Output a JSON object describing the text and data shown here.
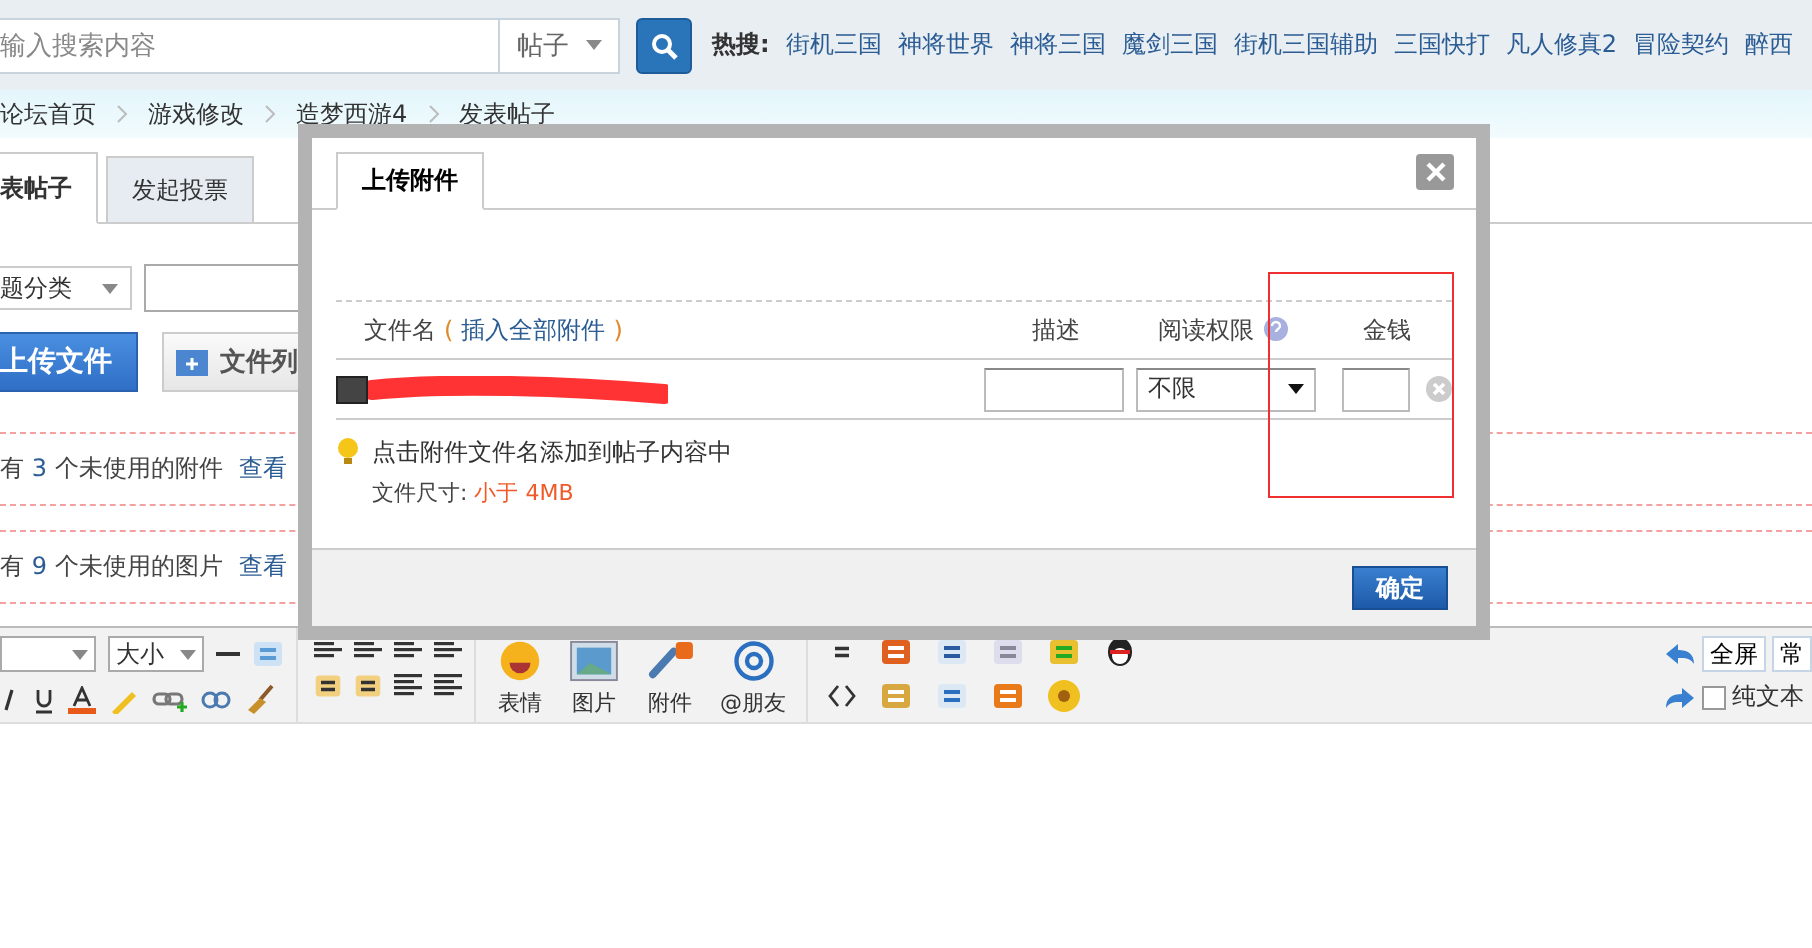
{
  "search": {
    "placeholder": "输入搜索内容",
    "scope": "帖子"
  },
  "hot_search": {
    "label": "热搜:",
    "links": [
      "街机三国",
      "神将世界",
      "神将三国",
      "魔剑三国",
      "街机三国辅助",
      "三国快打",
      "凡人修真2",
      "冒险契约",
      "醉西"
    ]
  },
  "breadcrumb": [
    "论坛首页",
    "游戏修改",
    "造梦西游4",
    "发表帖子"
  ],
  "tabs": [
    {
      "label": "表帖子",
      "selected": true
    },
    {
      "label": "发起投票",
      "selected": false
    }
  ],
  "category_select": {
    "value": "题分类"
  },
  "upload_buttons": [
    {
      "label": "上传文件",
      "kind": "primary"
    },
    {
      "label": "文件列",
      "kind": "secondary"
    }
  ],
  "unused_notices": [
    {
      "prefix": "有",
      "count": "3",
      "suffix": "个未使用的附件",
      "link": "查看"
    },
    {
      "prefix": "有",
      "count": "9",
      "suffix": "个未使用的图片",
      "link": "查看"
    }
  ],
  "editor_toolbar": {
    "font_size": "大小",
    "media_buttons": [
      "表情",
      "图片",
      "附件",
      "@朋友"
    ],
    "fullscreen": "全屏",
    "mode": "常",
    "plain_text": {
      "label": "纯文本",
      "checked": false
    }
  },
  "dialog": {
    "tab": "上传附件",
    "columns": {
      "filename": "文件名",
      "brackets": [
        "(",
        ")"
      ],
      "insert_all": "插入全部附件",
      "description": "描述",
      "permission": "阅读权限",
      "price": "金钱"
    },
    "attachments": [
      {
        "permission": "不限"
      }
    ],
    "tips": {
      "hint": "点击附件文件名添加到帖子内容中",
      "size_label": "文件尺寸:",
      "size_value": "小于 4MB"
    },
    "confirm": "确定"
  }
}
